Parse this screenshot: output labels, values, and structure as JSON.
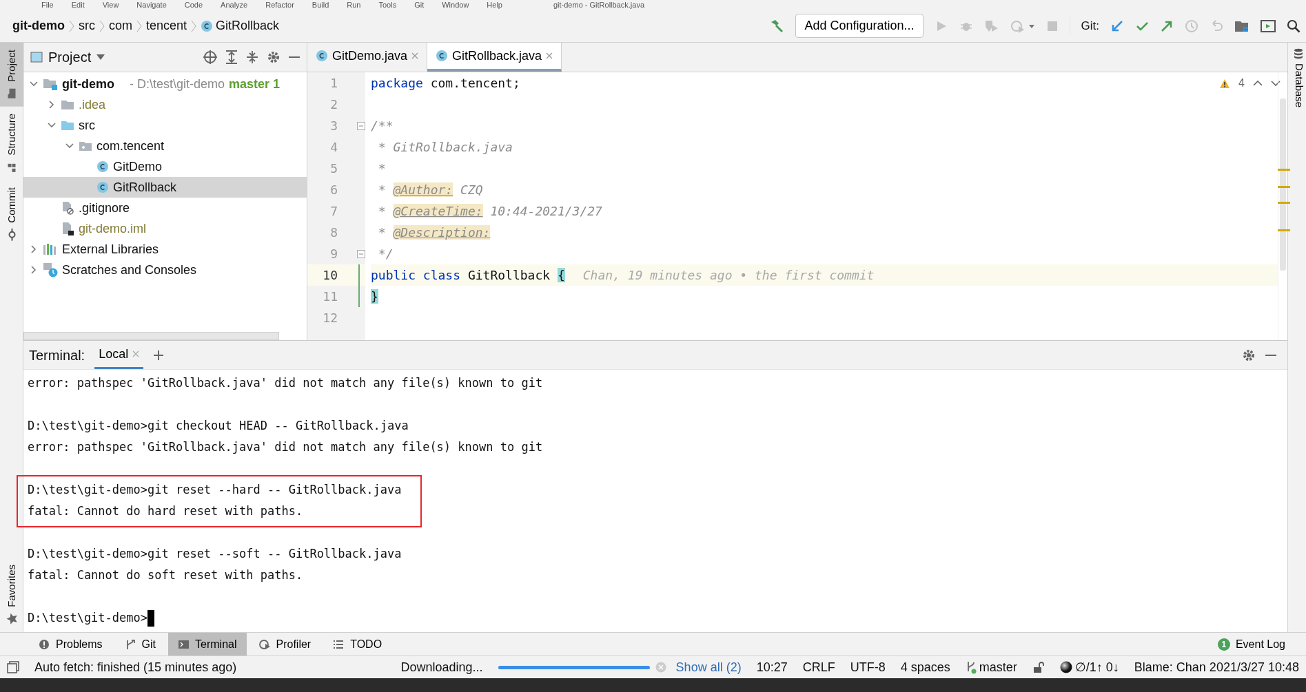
{
  "menu": [
    "File",
    "Edit",
    "View",
    "Navigate",
    "Code",
    "Analyze",
    "Refactor",
    "Build",
    "Run",
    "Tools",
    "Git",
    "Window",
    "Help"
  ],
  "window_title": "git-demo - GitRollback.java",
  "breadcrumb": [
    {
      "label": "git-demo",
      "kind": "project"
    },
    {
      "label": "src",
      "kind": "folder"
    },
    {
      "label": "com",
      "kind": "folder"
    },
    {
      "label": "tencent",
      "kind": "folder"
    },
    {
      "label": "GitRollback",
      "kind": "class"
    }
  ],
  "toolbar": {
    "run_config": "Add Configuration...",
    "git_label": "Git:"
  },
  "left_stripe": [
    {
      "label": "Project",
      "selected": true,
      "kind": "folder"
    },
    {
      "label": "Structure",
      "selected": false,
      "kind": "structure"
    },
    {
      "label": "Commit",
      "selected": false,
      "kind": "commit"
    }
  ],
  "left_stripe_bottom": [
    {
      "label": "Favorites",
      "selected": false,
      "kind": "star"
    }
  ],
  "right_stripe": [
    {
      "label": "Database"
    }
  ],
  "project_panel": {
    "title": "Project",
    "tree": [
      {
        "label": "git-demo",
        "kind": "project",
        "hint": "- D:\\test\\git-demo",
        "branch": "master 1",
        "expanded": true,
        "selected": false,
        "ignored": false,
        "children": [
          {
            "label": ".idea",
            "kind": "folder",
            "expanded": false,
            "selected": false,
            "ignored": true
          },
          {
            "label": "src",
            "kind": "source",
            "expanded": true,
            "selected": false,
            "ignored": false,
            "children": [
              {
                "label": "com.tencent",
                "kind": "package",
                "expanded": true,
                "selected": false,
                "ignored": false,
                "children": [
                  {
                    "label": "GitDemo",
                    "kind": "class",
                    "selected": false,
                    "ignored": false
                  },
                  {
                    "label": "GitRollback",
                    "kind": "class",
                    "selected": true,
                    "ignored": false
                  }
                ]
              }
            ]
          },
          {
            "label": ".gitignore",
            "kind": "gitignore",
            "selected": false,
            "ignored": false
          },
          {
            "label": "git-demo.iml",
            "kind": "iml",
            "selected": false,
            "ignored": true
          }
        ]
      },
      {
        "label": "External Libraries",
        "kind": "libraries",
        "expanded": false,
        "selected": false,
        "ignored": false
      },
      {
        "label": "Scratches and Consoles",
        "kind": "scratches",
        "expanded": false,
        "selected": false,
        "ignored": false
      }
    ]
  },
  "editor_tabs": [
    {
      "label": "GitDemo.java",
      "selected": false
    },
    {
      "label": "GitRollback.java",
      "selected": true
    }
  ],
  "editor": {
    "warnings": "4",
    "lines": [
      {
        "number": "1",
        "current": false,
        "tokens": [
          {
            "kind": "keyword",
            "text": "package"
          },
          {
            "kind": "plain",
            "text": " com.tencent;"
          }
        ]
      },
      {
        "number": "2",
        "current": false
      },
      {
        "number": "3",
        "current": false,
        "fold": true,
        "tokens": [
          {
            "kind": "comment",
            "text": "/**"
          }
        ]
      },
      {
        "number": "4",
        "current": false,
        "tokens": [
          {
            "kind": "comment",
            "text": " * GitRollback.java"
          }
        ]
      },
      {
        "number": "5",
        "current": false,
        "tokens": [
          {
            "kind": "comment",
            "text": " *"
          }
        ]
      },
      {
        "number": "6",
        "current": false,
        "tokens": [
          {
            "kind": "comment",
            "text": " * "
          },
          {
            "kind": "tag",
            "text": "@Author:"
          },
          {
            "kind": "comment",
            "text": " CZQ"
          }
        ]
      },
      {
        "number": "7",
        "current": false,
        "tokens": [
          {
            "kind": "comment",
            "text": " * "
          },
          {
            "kind": "tag",
            "text": "@CreateTime:"
          },
          {
            "kind": "comment",
            "text": " 10:44-2021/3/27"
          }
        ]
      },
      {
        "number": "8",
        "current": false,
        "tokens": [
          {
            "kind": "comment",
            "text": " * "
          },
          {
            "kind": "tag",
            "text": "@Description:"
          }
        ]
      },
      {
        "number": "9",
        "current": false,
        "fold": true,
        "tokens": [
          {
            "kind": "comment",
            "text": " */"
          }
        ]
      },
      {
        "number": "10",
        "current": true,
        "tokens": [
          {
            "kind": "keyword",
            "text": "public class"
          },
          {
            "kind": "plain",
            "text": " GitRollback "
          },
          {
            "kind": "brace",
            "text": "{"
          },
          {
            "kind": "blame",
            "text": "Chan, 19 minutes ago • the first commit"
          }
        ]
      },
      {
        "number": "11",
        "current": false,
        "tokens": [
          {
            "kind": "brace",
            "text": "}"
          }
        ]
      },
      {
        "number": "12",
        "current": false
      }
    ]
  },
  "terminal": {
    "title": "Terminal:",
    "tabs": [
      {
        "label": "Local",
        "selected": true
      }
    ],
    "blocks": [
      {
        "highlighted": false,
        "lines": [
          "error: pathspec 'GitRollback.java' did not match any file(s) known to git"
        ]
      },
      {
        "highlighted": false,
        "lines": [
          "D:\\test\\git-demo>git checkout HEAD -- GitRollback.java",
          "error: pathspec 'GitRollback.java' did not match any file(s) known to git"
        ]
      },
      {
        "highlighted": true,
        "lines": [
          "D:\\test\\git-demo>git reset --hard -- GitRollback.java",
          "fatal: Cannot do hard reset with paths."
        ]
      },
      {
        "highlighted": false,
        "lines": [
          "D:\\test\\git-demo>git reset --soft -- GitRollback.java",
          "fatal: Cannot do soft reset with paths."
        ]
      }
    ],
    "prompt": "D:\\test\\git-demo>"
  },
  "bottom_tabs": [
    {
      "label": "Problems",
      "kind": "problems",
      "selected": false
    },
    {
      "label": "Git",
      "kind": "git",
      "selected": false
    },
    {
      "label": "Terminal",
      "kind": "terminal",
      "selected": true
    },
    {
      "label": "Profiler",
      "kind": "profiler",
      "selected": false
    },
    {
      "label": "TODO",
      "kind": "todo",
      "selected": false
    }
  ],
  "event_log": {
    "count": "1",
    "label": "Event Log"
  },
  "status_bar": {
    "message": "Auto fetch: finished (15 minutes ago)",
    "task": "Downloading...",
    "level": 1,
    "show_all": "Show all (2)",
    "position": "10:27",
    "line_separator": "CRLF",
    "encoding": "UTF-8",
    "indent": "4 spaces",
    "branch": "master",
    "commits": "∅/1↑ 0↓",
    "blame": "Blame: Chan 2021/3/27 10:48"
  }
}
